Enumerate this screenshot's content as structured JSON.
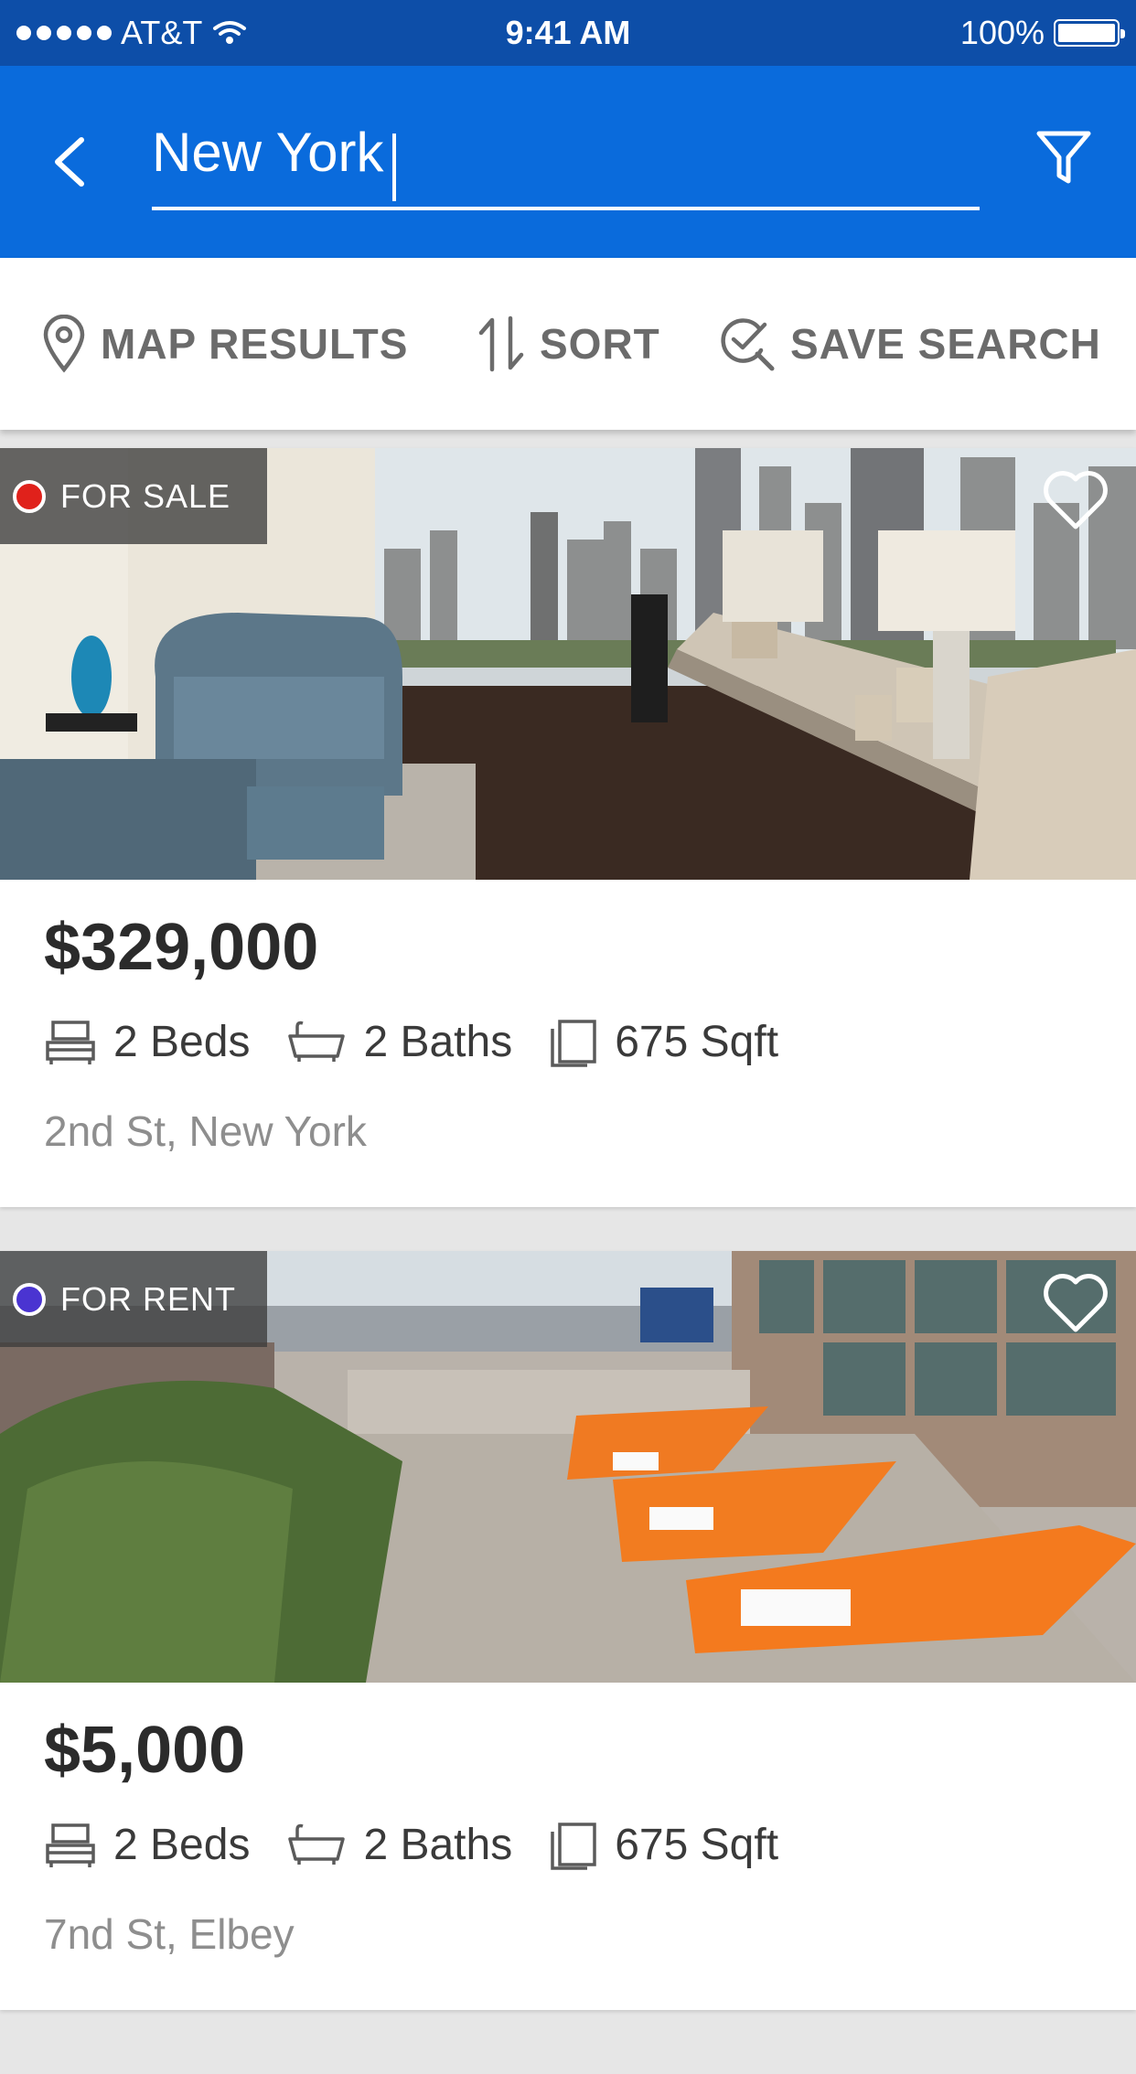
{
  "status_bar": {
    "carrier": "AT&T",
    "time": "9:41 AM",
    "battery": "100%",
    "battery_level": 1.0
  },
  "header": {
    "search_value": "New York",
    "back_icon": "chevron-left-icon",
    "filter_icon": "filter-icon"
  },
  "toolbar": {
    "map_label": "MAP RESULTS",
    "sort_label": "SORT",
    "save_label": "SAVE SEARCH"
  },
  "colors": {
    "header_bg": "#0a6bdc",
    "status_bg": "#0d4ea8",
    "for_sale_dot": "#e0211b",
    "for_rent_dot": "#4a34d1"
  },
  "listings": [
    {
      "badge": "FOR SALE",
      "badge_color": "#e0211b",
      "price": "$329,000",
      "beds": "2 Beds",
      "baths": "2 Baths",
      "sqft": "675 Sqft",
      "address": "2nd St, New York",
      "photo": "living room with city skyline view"
    },
    {
      "badge": "FOR RENT",
      "badge_color": "#4a34d1",
      "price": "$5,000",
      "beds": "2 Beds",
      "baths": "2 Baths",
      "sqft": "675 Sqft",
      "address": "7nd St, Elbey",
      "photo": "rooftop terrace with orange loungers"
    }
  ]
}
